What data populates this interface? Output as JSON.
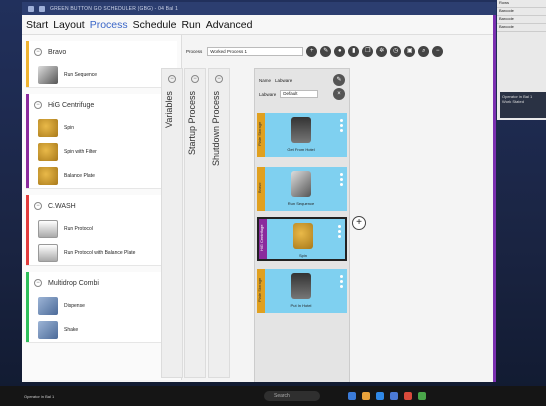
{
  "window": {
    "title_small": "GREEN BUTTON GO SCHEDULER (GBG) - 04 Bal 1"
  },
  "menu": [
    "Start",
    "Layout",
    "Process",
    "Schedule",
    "Run",
    "Advanced"
  ],
  "menu_active": "Process",
  "left_panel": {
    "groups": [
      {
        "title": "Bravo",
        "color": "#f0b431",
        "steps": [
          {
            "label": "Run Sequence",
            "icon": "bravo-icon"
          }
        ]
      },
      {
        "title": "HiG Centrifuge",
        "color": "#8a2b9d",
        "steps": [
          {
            "label": "Spin",
            "icon": "centrifuge-icon"
          },
          {
            "label": "Spin with Filter",
            "icon": "centrifuge-icon"
          },
          {
            "label": "Balance Plate",
            "icon": "centrifuge-icon"
          }
        ]
      },
      {
        "title": "C.WASH",
        "color": "#e23c3c",
        "steps": [
          {
            "label": "Run Protocol",
            "icon": "washer-icon"
          },
          {
            "label": "Run Protocol with Balance Plate",
            "icon": "washer-icon"
          }
        ]
      },
      {
        "title": "Multidrop Combi",
        "color": "#2fbf5b",
        "steps": [
          {
            "label": "Dispense",
            "icon": "dispenser-icon"
          },
          {
            "label": "Shake",
            "icon": "dispenser-icon"
          }
        ]
      }
    ]
  },
  "vertical_tabs": [
    "Variables",
    "Startup Process",
    "Shutdown Process"
  ],
  "process_toolbar": {
    "label": "Process",
    "selected": "Worked Process 1",
    "icons": [
      "add-icon",
      "edit-icon",
      "user-icon",
      "delete-icon",
      "copy-icon",
      "settings-icon",
      "timer-icon",
      "save-icon",
      "search-icon",
      "minus-icon"
    ]
  },
  "process_panel": {
    "name_label": "Name",
    "name_value": "Labware",
    "labware_label": "Labware",
    "labware_value": "Default",
    "cards": [
      {
        "side": "Plate Storage",
        "label": "Get From Hotel",
        "color": "#e0a020"
      },
      {
        "side": "Bravo",
        "label": "Run Sequence",
        "color": "#e0a020"
      },
      {
        "side": "HiG Centrifuge",
        "label": "Spin",
        "color": "#8a2b9d"
      },
      {
        "side": "Plate Storage",
        "label": "Put In Hotel",
        "color": "#e0a020"
      }
    ]
  },
  "taskbar": {
    "left_text": "Operator in Bal 1",
    "search_label": "Search"
  },
  "side_window": {
    "rows": [
      "Rows",
      "Barcode",
      "Barcode",
      "Barcode"
    ],
    "popup_title": "Operator in Bal 1",
    "popup_body": "Work Stated"
  }
}
